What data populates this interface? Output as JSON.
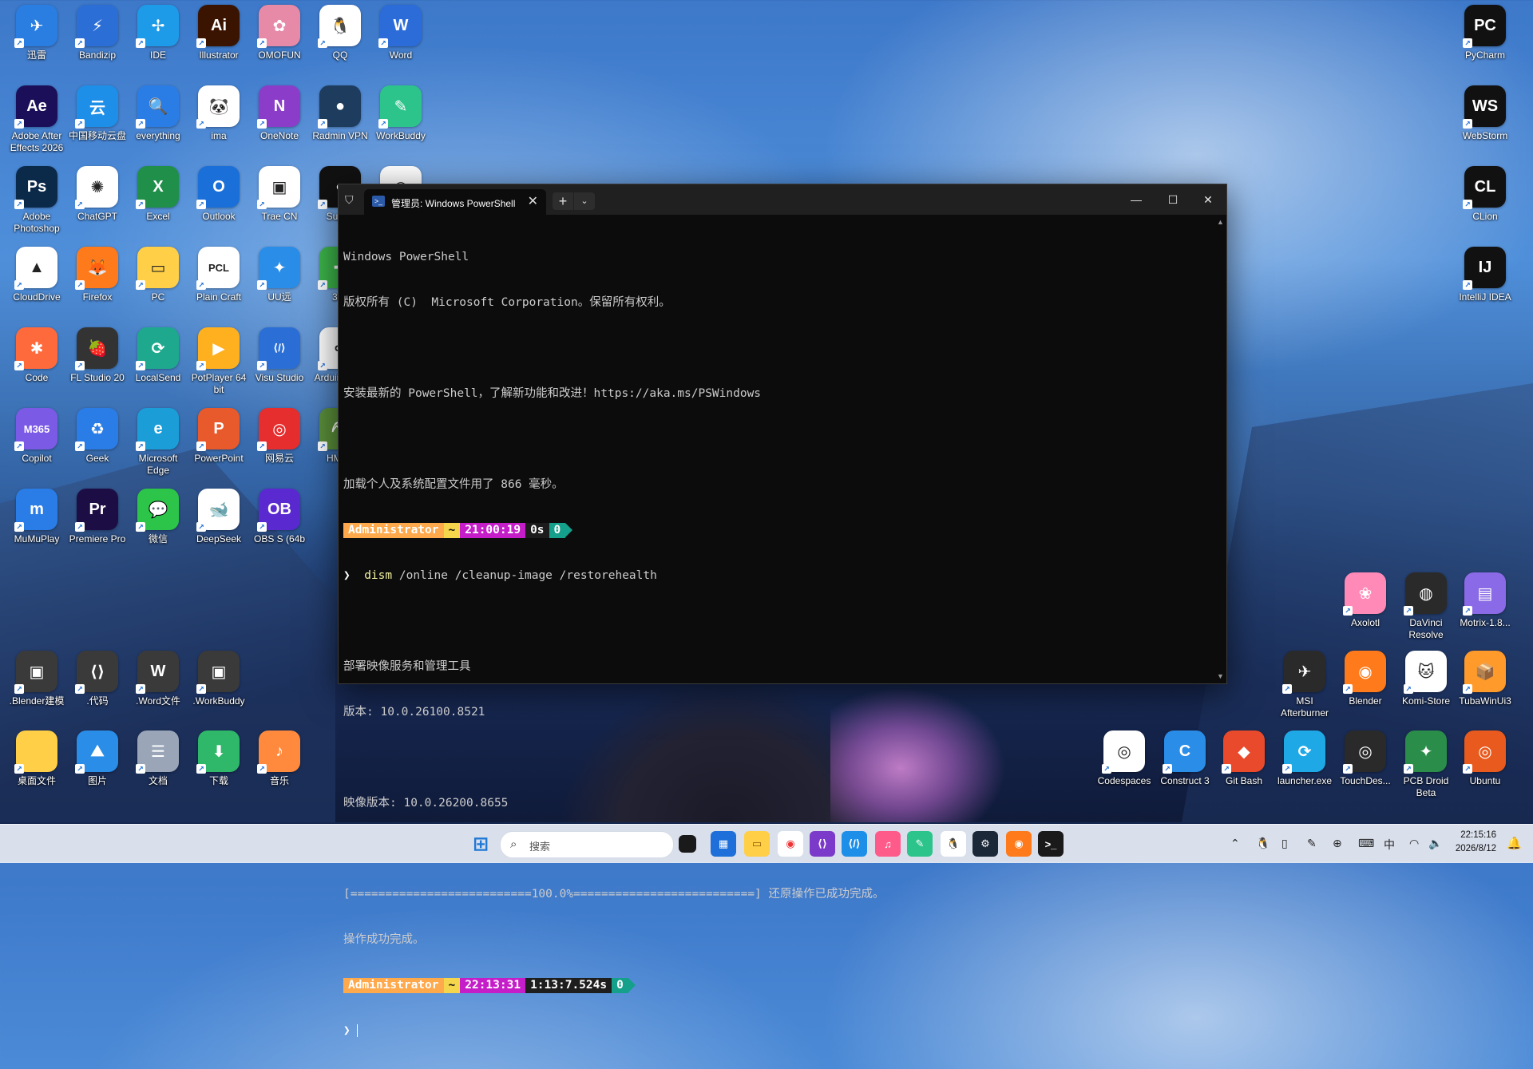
{
  "desktop": {
    "icons": [
      {
        "label": "迅雷",
        "glyph": "✈",
        "color": "#2a7de1"
      },
      {
        "label": "Bandizip",
        "glyph": "⚡",
        "color": "#2b6fd6"
      },
      {
        "label": "IDE",
        "glyph": "✢",
        "color": "#1e9be8"
      },
      {
        "label": "Illustrator",
        "glyph": "Ai",
        "color": "#3a1400"
      },
      {
        "label": "OMOFUN",
        "glyph": "✿",
        "color": "#e68aa8"
      },
      {
        "label": "QQ",
        "glyph": "🐧",
        "color": "#ffffff"
      },
      {
        "label": "Word",
        "glyph": "W",
        "color": "#2b6cd9"
      },
      {
        "label": "Adobe After Effects 2026",
        "glyph": "Ae",
        "color": "#1c0f5a"
      },
      {
        "label": "中国移动云盘",
        "glyph": "云",
        "color": "#1e8fe8"
      },
      {
        "label": "everything",
        "glyph": "🔍",
        "color": "#2b7de6"
      },
      {
        "label": "ima",
        "glyph": "🐼",
        "color": "#ffffff"
      },
      {
        "label": "OneNote",
        "glyph": "N",
        "color": "#8b3dc9"
      },
      {
        "label": "Radmin VPN",
        "glyph": "●",
        "color": "#1d3c5e"
      },
      {
        "label": "WorkBuddy",
        "glyph": "✎",
        "color": "#2cc48b"
      },
      {
        "label": "Adobe Photoshop",
        "glyph": "Ps",
        "color": "#0b2a4a"
      },
      {
        "label": "ChatGPT",
        "glyph": "✺",
        "color": "#ffffff"
      },
      {
        "label": "Excel",
        "glyph": "X",
        "color": "#1f8f4a"
      },
      {
        "label": "Outlook",
        "glyph": "O",
        "color": "#1a6fd8"
      },
      {
        "label": "Trae CN",
        "glyph": "▣",
        "color": "#ffffff"
      },
      {
        "label": "Superl",
        "glyph": "●",
        "color": "#111111"
      },
      {
        "label": "Google Chrome",
        "glyph": "◉",
        "color": "#ffffff"
      },
      {
        "label": "CloudDrive",
        "glyph": "▲",
        "color": "#ffffff"
      },
      {
        "label": "Firefox",
        "glyph": "🦊",
        "color": "#ff7a1a"
      },
      {
        "label": "PC",
        "glyph": "▭",
        "color": "#ffcf47"
      },
      {
        "label": "Plain Craft",
        "glyph": "PCL",
        "color": "#ffffff"
      },
      {
        "label": "UU远",
        "glyph": "✦",
        "color": "#2a8de8"
      },
      {
        "label": "360",
        "glyph": "✚",
        "color": "#3cb54a"
      },
      {
        "label": "Code",
        "glyph": "✱",
        "color": "#ff6a3d"
      },
      {
        "label": "FL Studio 20",
        "glyph": "🍓",
        "color": "#333333"
      },
      {
        "label": "LocalSend",
        "glyph": "⟳",
        "color": "#1ea98e"
      },
      {
        "label": "PotPlayer 64 bit",
        "glyph": "▶",
        "color": "#ffb01f"
      },
      {
        "label": "Visu Studio",
        "glyph": "⟨/⟩",
        "color": "#2b6fd6"
      },
      {
        "label": "Arduino IDE",
        "glyph": "∞",
        "color": "#ffffff"
      },
      {
        "label": "Copilot",
        "glyph": "M365",
        "color": "#7b5ae6"
      },
      {
        "label": "Geek",
        "glyph": "♻",
        "color": "#2a7de6"
      },
      {
        "label": "Microsoft Edge",
        "glyph": "e",
        "color": "#1b9ed8"
      },
      {
        "label": "PowerPoint",
        "glyph": "P",
        "color": "#e85a2b"
      },
      {
        "label": "网易云",
        "glyph": "◎",
        "color": "#e62e2e"
      },
      {
        "label": "HMCL",
        "glyph": "⛏",
        "color": "#5a8f3a"
      },
      {
        "label": "MuMuPlay",
        "glyph": "m",
        "color": "#2a7de6"
      },
      {
        "label": "Premiere Pro",
        "glyph": "Pr",
        "color": "#1d0d45"
      },
      {
        "label": "微信",
        "glyph": "💬",
        "color": "#2dc44a"
      },
      {
        "label": "DeepSeek",
        "glyph": "🐋",
        "color": "#ffffff"
      },
      {
        "label": "OBS S (64b",
        "glyph": "OB",
        "color": "#5a2ad0"
      },
      {
        "label": ".Blender建模",
        "glyph": "▣",
        "color": "#3a3a3a"
      },
      {
        "label": ".代码",
        "glyph": "⟨⟩",
        "color": "#3a3a3a"
      },
      {
        "label": ".Word文件",
        "glyph": "W",
        "color": "#3a3a3a"
      },
      {
        "label": ".WorkBuddy",
        "glyph": "▣",
        "color": "#3a3a3a"
      },
      {
        "label": "桌面文件",
        "glyph": "",
        "color": "#ffcf47"
      },
      {
        "label": "图片",
        "glyph": "⛰",
        "color": "#2a8de8"
      },
      {
        "label": "文档",
        "glyph": "☰",
        "color": "#9aa6b8"
      },
      {
        "label": "下载",
        "glyph": "⬇",
        "color": "#2fb86a"
      },
      {
        "label": "音乐",
        "glyph": "♪",
        "color": "#ff8a3d"
      },
      {
        "label": "PyCharm",
        "glyph": "PC",
        "color": "#111111"
      },
      {
        "label": "WebStorm",
        "glyph": "WS",
        "color": "#111111"
      },
      {
        "label": "CLion",
        "glyph": "CL",
        "color": "#111111"
      },
      {
        "label": "IntelliJ IDEA",
        "glyph": "IJ",
        "color": "#111111"
      },
      {
        "label": "Axolotl",
        "glyph": "❀",
        "color": "#ff8ab8"
      },
      {
        "label": "DaVinci Resolve",
        "glyph": "◍",
        "color": "#2a2a2a"
      },
      {
        "label": "Motrix-1.8...",
        "glyph": "▤",
        "color": "#8a6ae6"
      },
      {
        "label": "MSI Afterburner",
        "glyph": "✈",
        "color": "#2a2a2a"
      },
      {
        "label": "Blender",
        "glyph": "◉",
        "color": "#ff7a1a"
      },
      {
        "label": "Komi-Store",
        "glyph": "🐱",
        "color": "#ffffff"
      },
      {
        "label": "TubaWinUi3",
        "glyph": "📦",
        "color": "#ff9a2b"
      },
      {
        "label": "Codespaces",
        "glyph": "◎",
        "color": "#ffffff"
      },
      {
        "label": "Construct 3",
        "glyph": "C",
        "color": "#2a8de8"
      },
      {
        "label": "Git Bash",
        "glyph": "◆",
        "color": "#e84a2b"
      },
      {
        "label": "launcher.exe",
        "glyph": "⟳",
        "color": "#1ea8e6"
      },
      {
        "label": "TouchDes...",
        "glyph": "◎",
        "color": "#2a2a2a"
      },
      {
        "label": "PCB Droid Beta",
        "glyph": "✦",
        "color": "#2a8d4a"
      },
      {
        "label": "Ubuntu",
        "glyph": "◎",
        "color": "#e85a1d"
      }
    ]
  },
  "terminal": {
    "tab_title": "管理员: Windows PowerShell",
    "new_tab": "+",
    "dropdown": "⌄",
    "close_tab": "✕",
    "minimize": "—",
    "maximize": "☐",
    "close": "✕",
    "lines": {
      "l1": "Windows PowerShell",
      "l2": "版权所有 (C)  Microsoft Corporation。保留所有权利。",
      "l3": "安装最新的 PowerShell，了解新功能和改进！https://aka.ms/PSWindows",
      "l4": "加载个人及系统配置文件用了 866 毫秒。",
      "l6_cmd": "dism",
      "l6_args": " /online /cleanup-image /restorehealth",
      "l7": "部署映像服务和管理工具",
      "l8": "版本: 10.0.26100.8521",
      "l9": "映像版本: 10.0.26200.8655",
      "l10": "[==========================100.0%==========================] 还原操作已成功完成。",
      "l11": "操作成功完成。"
    },
    "prompt1": {
      "user": "Administrator",
      "dir": "~",
      "time": "21:00:19",
      "duration": "0s",
      "code": "0"
    },
    "prompt2": {
      "user": "Administrator",
      "dir": "~",
      "time": "22:13:31",
      "duration": "1:13:7.524s",
      "code": "0"
    },
    "caret": "❯"
  },
  "taskbar": {
    "search_placeholder": "搜索",
    "ime": "中",
    "time": "22:15:16",
    "date": "2026/8/12"
  }
}
